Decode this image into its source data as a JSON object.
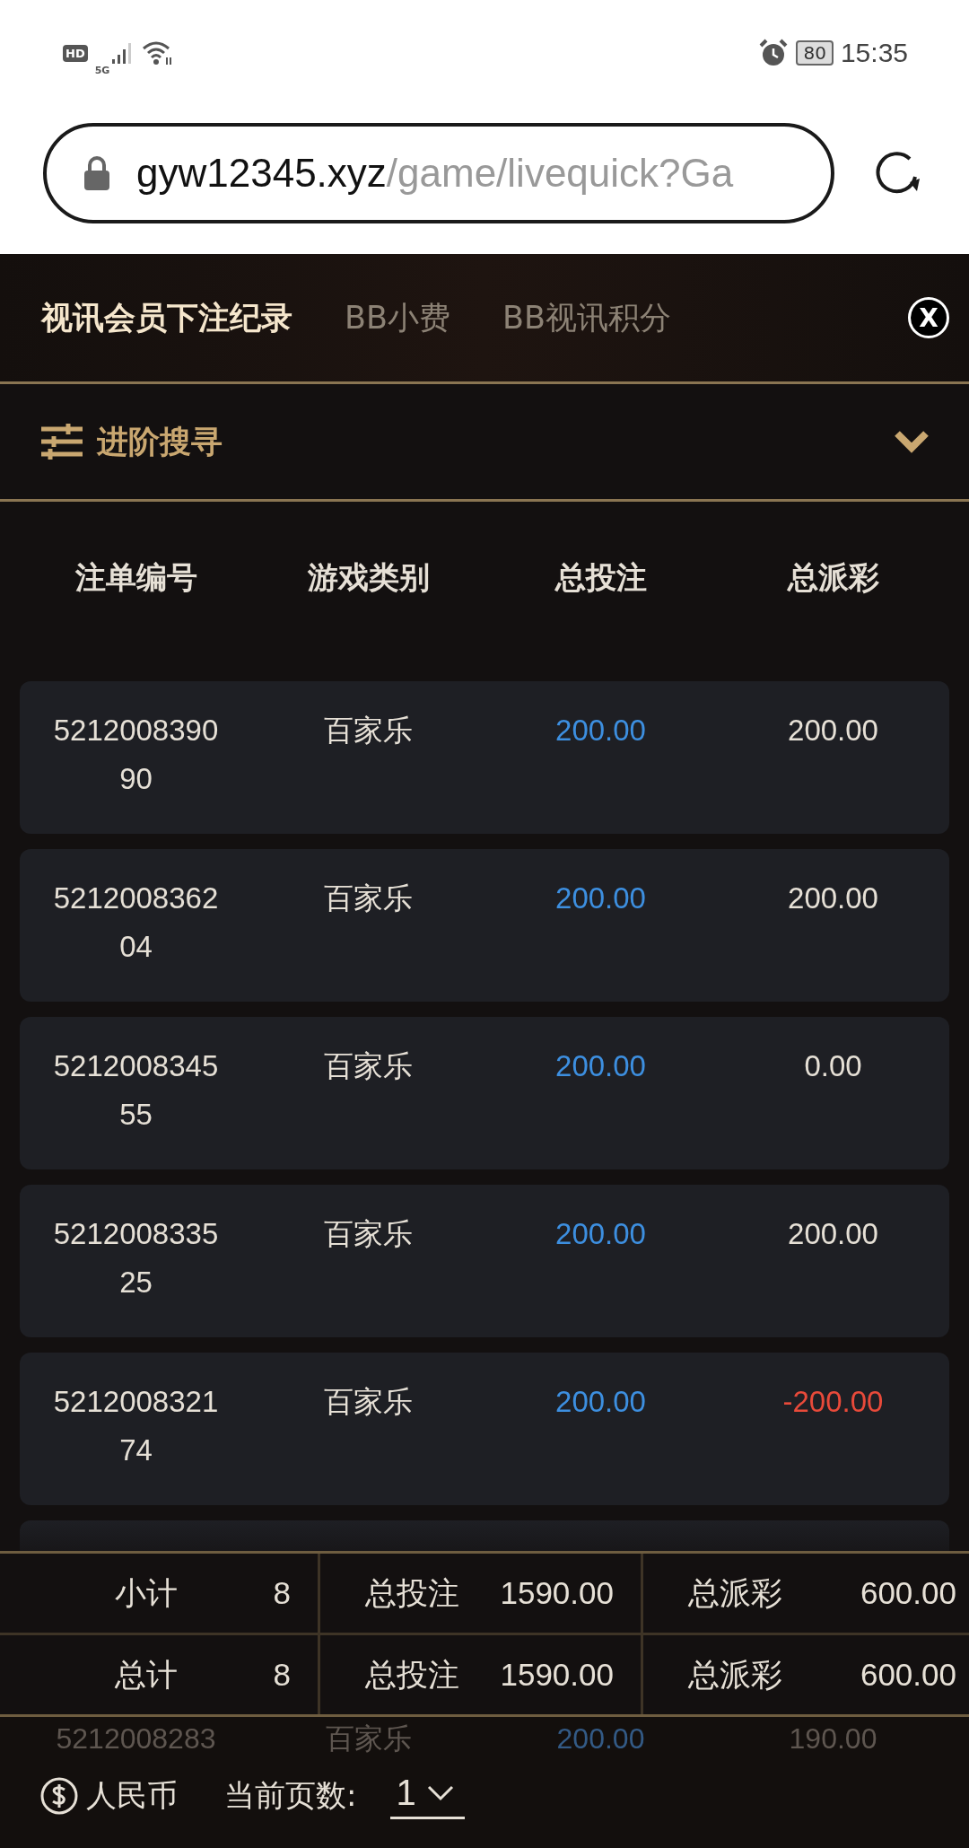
{
  "status_bar": {
    "hd": "HD",
    "network": "5G",
    "battery": "80",
    "time": "15:35"
  },
  "address_bar": {
    "domain": "gyw12345.xyz",
    "path": "/game/livequick?Ga"
  },
  "tabs": [
    {
      "label": "视讯会员下注纪录",
      "selected": true
    },
    {
      "label": "BB小费",
      "selected": false
    },
    {
      "label": "BB视讯积分",
      "selected": false
    }
  ],
  "close_button": "X",
  "advanced_search": {
    "label": "进阶搜寻",
    "expanded": false
  },
  "table": {
    "columns": [
      "注单编号",
      "游戏类别",
      "总投注",
      "总派彩"
    ],
    "rows": [
      {
        "id": "521200839090",
        "game": "百家乐",
        "bet": "200.00",
        "payout": "200.00",
        "negative": false
      },
      {
        "id": "521200836204",
        "game": "百家乐",
        "bet": "200.00",
        "payout": "200.00",
        "negative": false
      },
      {
        "id": "521200834555",
        "game": "百家乐",
        "bet": "200.00",
        "payout": "0.00",
        "negative": false
      },
      {
        "id": "521200833525",
        "game": "百家乐",
        "bet": "200.00",
        "payout": "200.00",
        "negative": false
      },
      {
        "id": "521200832174",
        "game": "百家乐",
        "bet": "200.00",
        "payout": "-200.00",
        "negative": true
      }
    ],
    "faded_row": {
      "id": "5212008283",
      "game": "百家乐",
      "bet": "200.00",
      "payout": "190.00"
    }
  },
  "totals": [
    {
      "label": "小计",
      "count": "8",
      "bet_label": "总投注",
      "bet": "1590.00",
      "payout_label": "总派彩",
      "payout": "600.00"
    },
    {
      "label": "总计",
      "count": "8",
      "bet_label": "总投注",
      "bet": "1590.00",
      "payout_label": "总派彩",
      "payout": "600.00"
    }
  ],
  "footer": {
    "currency": "人民币",
    "page_label": "当前页数:",
    "page": "1"
  }
}
